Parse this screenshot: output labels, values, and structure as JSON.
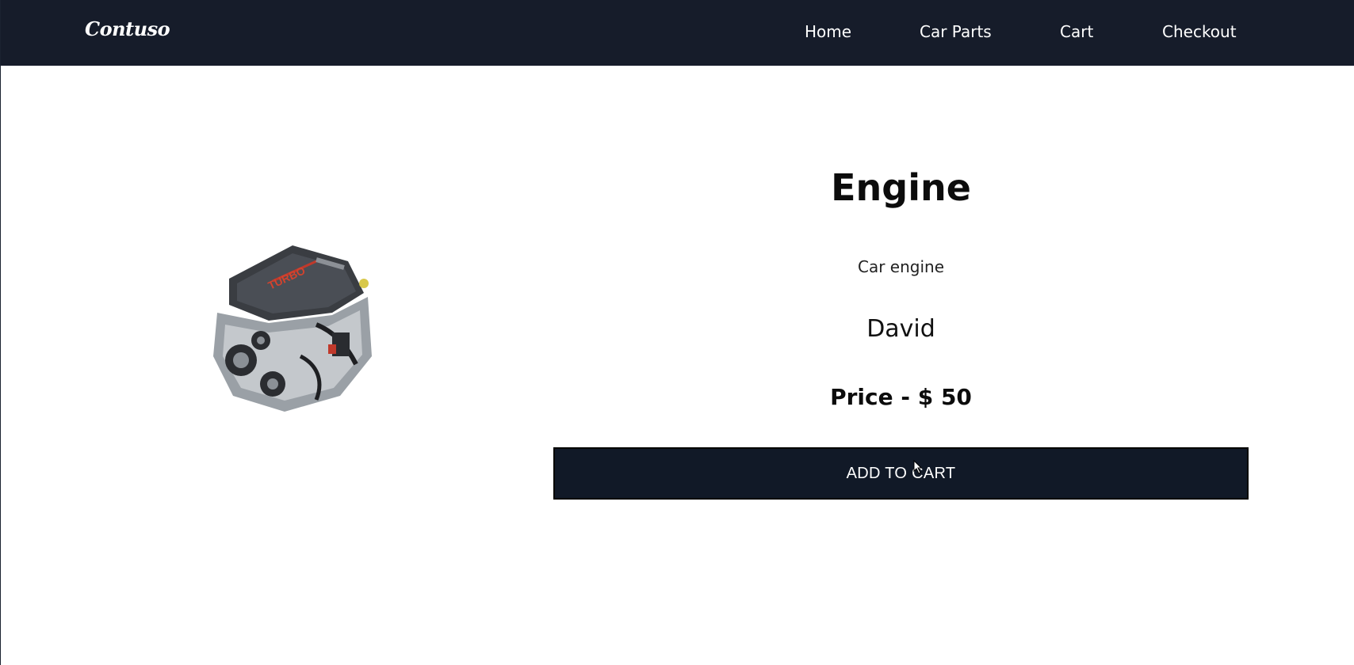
{
  "navbar": {
    "logo": "Contuso",
    "links": [
      {
        "label": "Home"
      },
      {
        "label": "Car Parts"
      },
      {
        "label": "Cart"
      },
      {
        "label": "Checkout"
      }
    ]
  },
  "product": {
    "image_icon": "car-engine-image",
    "title": "Engine",
    "description": "Car engine",
    "seller": "David",
    "price": "Price - $ 50",
    "add_to_cart_label": "ADD TO CART"
  },
  "colors": {
    "navbar_bg": "#161c2a",
    "button_bg": "#111927",
    "text": "#0c0c0c"
  }
}
